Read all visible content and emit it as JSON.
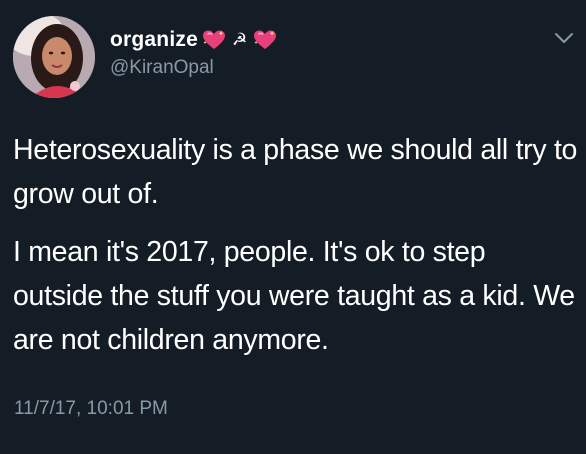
{
  "user": {
    "display_name": "organize",
    "hammer_sickle": "☭",
    "handle": "@KiranOpal"
  },
  "tweet": {
    "paragraphs": [
      "Heterosexuality is a phase we should all try to grow out of.",
      "I mean it's 2017, people. It's ok to step outside the stuff you were taught as a kid. We are not children anymore."
    ],
    "timestamp": "11/7/17, 10:01 PM"
  },
  "icons": {
    "avatar": "profile-photo",
    "name_emoji_left": "sparkling-heart-icon",
    "name_emoji_right": "sparkling-heart-icon",
    "menu": "chevron-down-icon"
  },
  "colors": {
    "background": "#141d26",
    "primary_text": "#ffffff",
    "secondary_text": "#8899a6",
    "heart": "#e8407a"
  }
}
